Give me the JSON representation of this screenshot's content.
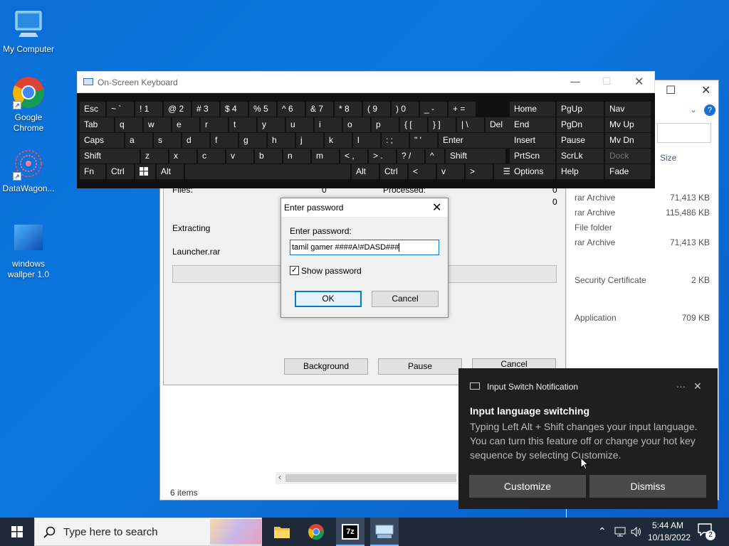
{
  "desktop": {
    "icons": [
      {
        "label": "My Computer"
      },
      {
        "label": "Google Chrome"
      },
      {
        "label": "DataWagon..."
      },
      {
        "label": "windows wallper 1.0"
      }
    ]
  },
  "explorer": {
    "col_size": "Size",
    "rows": [
      {
        "type": "rar Archive",
        "size": "71,413 KB"
      },
      {
        "type": "rar Archive",
        "size": "115,486 KB"
      },
      {
        "type": "File folder",
        "size": ""
      },
      {
        "type": "rar Archive",
        "size": "71,413 KB"
      },
      {
        "type": "Security Certificate",
        "size": "2 KB"
      },
      {
        "type": "Application",
        "size": "709 KB"
      }
    ],
    "status": "6 items"
  },
  "extract_dialog": {
    "files_label": "Files:",
    "files_value": "0",
    "processed_label": "Processed:",
    "processed_value": "0",
    "extra_value": "0",
    "extracting_label": "Extracting",
    "filename": "Launcher.rar",
    "progress": 0,
    "background_label": "Background",
    "pause_label": "Pause",
    "cancel_label": "Cancel"
  },
  "osk": {
    "title": "On-Screen Keyboard",
    "rows": [
      [
        "Esc",
        "~ `",
        "! 1",
        "@ 2",
        "# 3",
        "$ 4",
        "% 5",
        "^ 6",
        "& 7",
        "* 8",
        "( 9",
        ") 0",
        "_ -",
        "+ ="
      ],
      [
        "Tab",
        "q",
        "w",
        "e",
        "r",
        "t",
        "y",
        "u",
        "i",
        "o",
        "p",
        "{ [",
        "} ]",
        "| \\",
        "Del"
      ],
      [
        "Caps",
        "a",
        "s",
        "d",
        "f",
        "g",
        "h",
        "j",
        "k",
        "l",
        ": ;",
        "\" '",
        "Enter"
      ],
      [
        "Shift",
        "z",
        "x",
        "c",
        "v",
        "b",
        "n",
        "m",
        "< ,",
        "> .",
        "? /",
        "^",
        "Shift"
      ],
      [
        "Fn",
        "Ctrl",
        "Alt",
        "Alt",
        "Ctrl",
        "<",
        "v",
        ">"
      ]
    ],
    "nav_keys": [
      [
        "Home",
        "PgUp",
        "Nav"
      ],
      [
        "End",
        "PgDn",
        "Mv Up"
      ],
      [
        "Insert",
        "Pause",
        "Mv Dn"
      ],
      [
        "PrtScn",
        "ScrLk",
        "Dock"
      ],
      [
        "Options",
        "Help",
        "Fade"
      ]
    ]
  },
  "password_dialog": {
    "title": "Enter password",
    "label": "Enter password:",
    "value": "tamil gamer ####A!#DASD###",
    "show_password_label": "Show password",
    "show_password_checked": true,
    "ok_label": "OK",
    "cancel_label": "Cancel"
  },
  "notification": {
    "app": "Input Switch Notification",
    "title": "Input language switching",
    "body": "Typing Left Alt + Shift changes your input language. You can turn this feature off or change your hot key sequence by selecting Customize.",
    "customize_label": "Customize",
    "dismiss_label": "Dismiss",
    "more_label": "···"
  },
  "taskbar": {
    "search_placeholder": "Type here to search",
    "time": "5:44 AM",
    "date": "10/18/2022",
    "notif_count": "2"
  },
  "colors": {
    "desktop": "#0a6fd6",
    "taskbar": "#1e2a3a",
    "notification_bg": "#1f1f1f",
    "osk_bg": "#111111",
    "accent": "#0078d7"
  }
}
